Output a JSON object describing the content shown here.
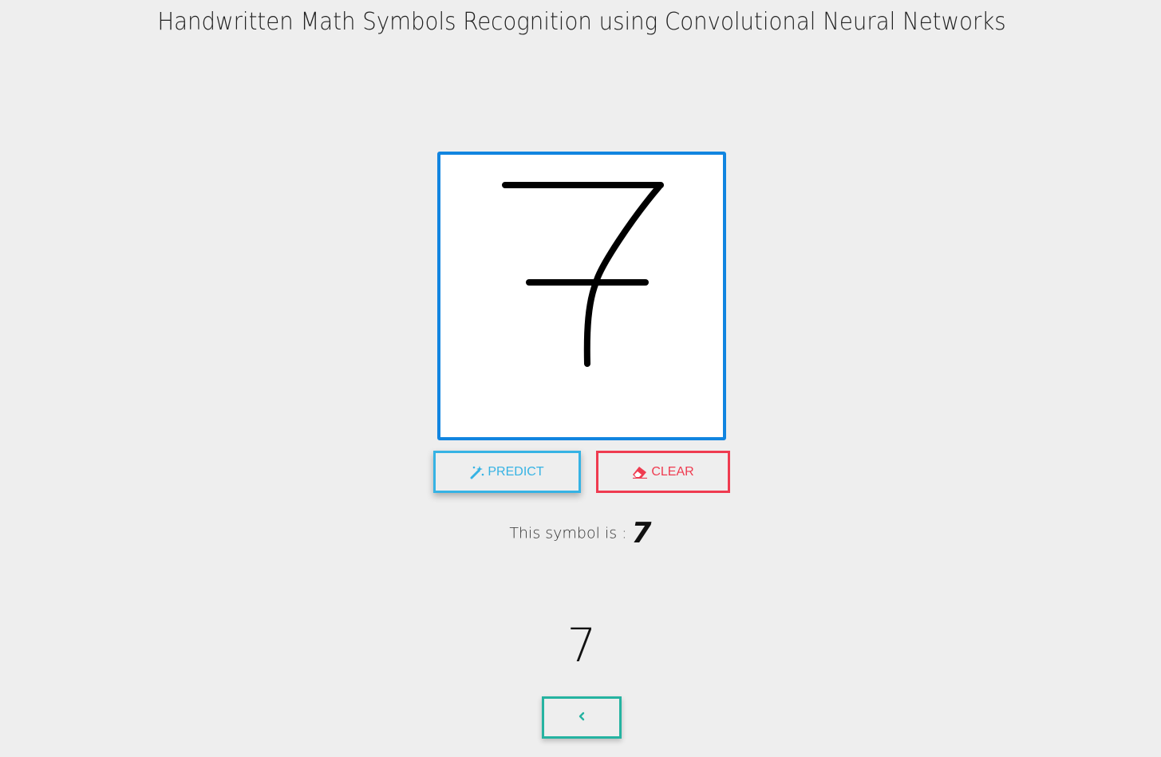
{
  "header": {
    "title": "Handwritten Math Symbols Recognition using Convolutional Neural Networks"
  },
  "canvas": {
    "border_color": "#1185e0",
    "stroke_color": "#000000"
  },
  "buttons": {
    "predict_label": "PREDICT",
    "predict_icon": "magic-wand-icon",
    "predict_color": "#36b3e4",
    "clear_label": "CLEAR",
    "clear_icon": "eraser-icon",
    "clear_color": "#ef3b50",
    "back_icon": "chevron-left-icon",
    "back_color": "#25b3a1"
  },
  "result": {
    "label": "This symbol is :",
    "value": "7"
  },
  "display": {
    "symbol": "7"
  }
}
